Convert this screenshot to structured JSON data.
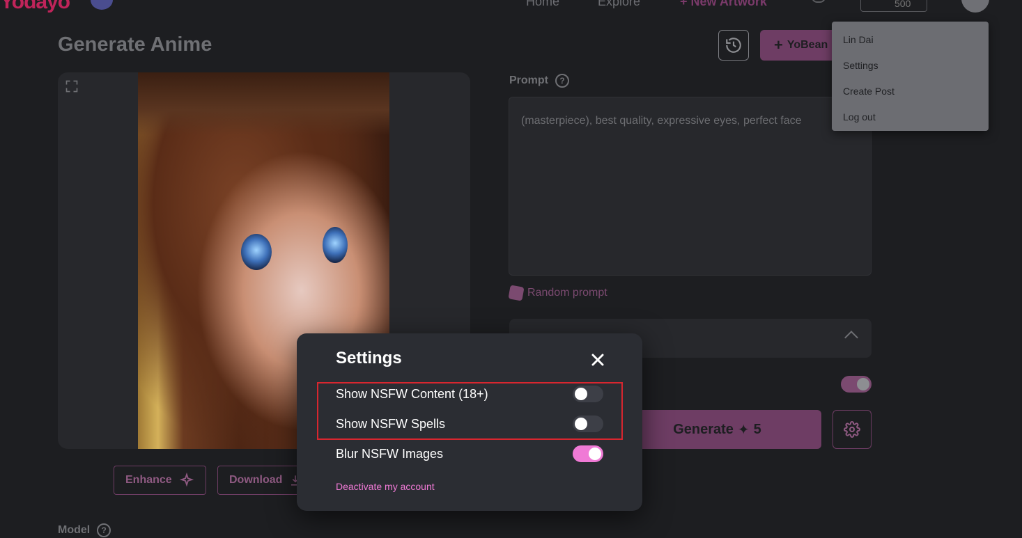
{
  "nav": {
    "logo": "Yodayo",
    "home": "Home",
    "explore": "Explore",
    "new_artwork": "New Artwork",
    "credits": "500"
  },
  "page": {
    "title": "Generate Anime",
    "yobean_label": "YoBean"
  },
  "tools": {
    "enhance_label": "Enhance",
    "download_label": "Download"
  },
  "prompt": {
    "label": "Prompt",
    "value": "(masterpiece), best quality, expressive eyes, perfect face",
    "random_label": "Random prompt"
  },
  "generate": {
    "label": "Generate",
    "cost": "5"
  },
  "model": {
    "label": "Model"
  },
  "dropdown": {
    "items": [
      "Lin Dai",
      "Settings",
      "Create Post",
      "Log out"
    ]
  },
  "settings_modal": {
    "title": "Settings",
    "rows": [
      {
        "label": "Show NSFW Content (18+)",
        "enabled": false
      },
      {
        "label": "Show NSFW Spells",
        "enabled": false
      },
      {
        "label": "Blur NSFW Images",
        "enabled": true
      }
    ],
    "deactivate_label": "Deactivate my account"
  },
  "colors": {
    "accent": "#f07ad6",
    "highlight": "#d8262f",
    "modal_bg": "#2b2d33"
  }
}
